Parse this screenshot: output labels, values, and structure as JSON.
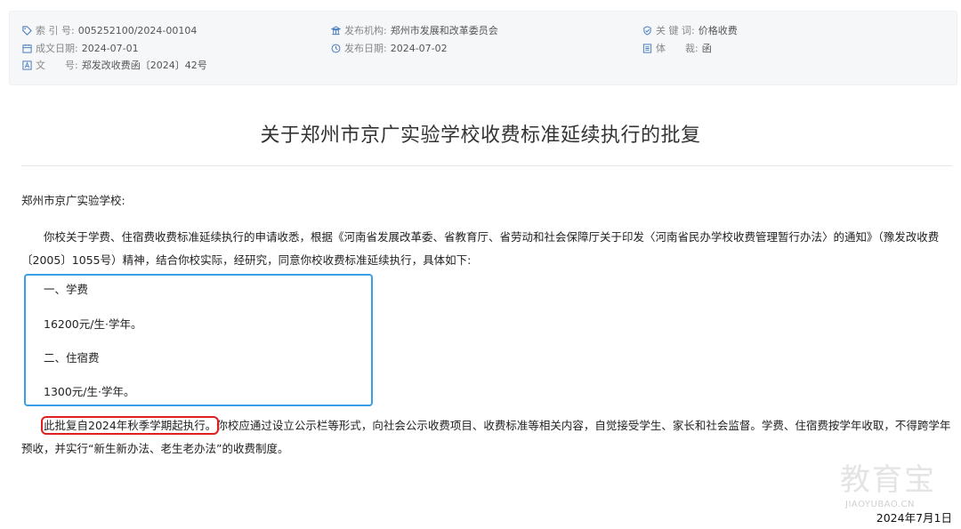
{
  "meta": {
    "index_label": "索 引 号:",
    "index_value": "005252100/2024-00104",
    "org_label": "发布机构:",
    "org_value": "郑州市发展和改革委员会",
    "keyword_label": "关 键 词:",
    "keyword_value": "价格收费",
    "made_label": "成文日期:",
    "made_value": "2024-07-01",
    "pub_label": "发布日期:",
    "pub_value": "2024-07-02",
    "genre_label": "体　　裁:",
    "genre_value": "函",
    "docno_label": "文　　号:",
    "docno_value": "郑发改收费函〔2024〕42号"
  },
  "doc": {
    "title": "关于郑州市京广实验学校收费标准延续执行的批复",
    "salutation": "郑州市京广实验学校:",
    "body1": "你校关于学费、住宿费收费标准延续执行的申请收悉，根据《河南省发展改革委、省教育厅、省劳动和社会保障厅关于印发〈河南省民办学校收费管理暂行办法〉的通知》（豫发改收费〔2005〕1055号）精神，结合你校实际，经研究，同意你校收费标准延续执行，具体如下:",
    "items": [
      "一、学费",
      "16200元/生·学年。",
      "二、住宿费",
      "1300元/生·学年。"
    ],
    "body2_highlight": "此批复自2024年秋季学期起执行。",
    "body2_rest": "你校应通过设立公示栏等形式，向社会公示收费项目、收费标准等相关内容，自觉接受学生、家长和社会监督。学费、住宿费按学年收取，不得跨学年预收，并实行“新生新办法、老生老办法”的收费制度。"
  },
  "watermark": {
    "logo": "教育宝",
    "site": "JIAOYUBAO.CN"
  },
  "date": "2024年7月1日",
  "icons": [
    "tag-icon",
    "bank-icon",
    "check-shield-icon",
    "calendar-icon",
    "clock-icon",
    "list-icon",
    "text-icon"
  ],
  "colors": {
    "icon": "#4a7fc1",
    "box_border": "#3aa0e6",
    "highlight": "#e02020"
  }
}
